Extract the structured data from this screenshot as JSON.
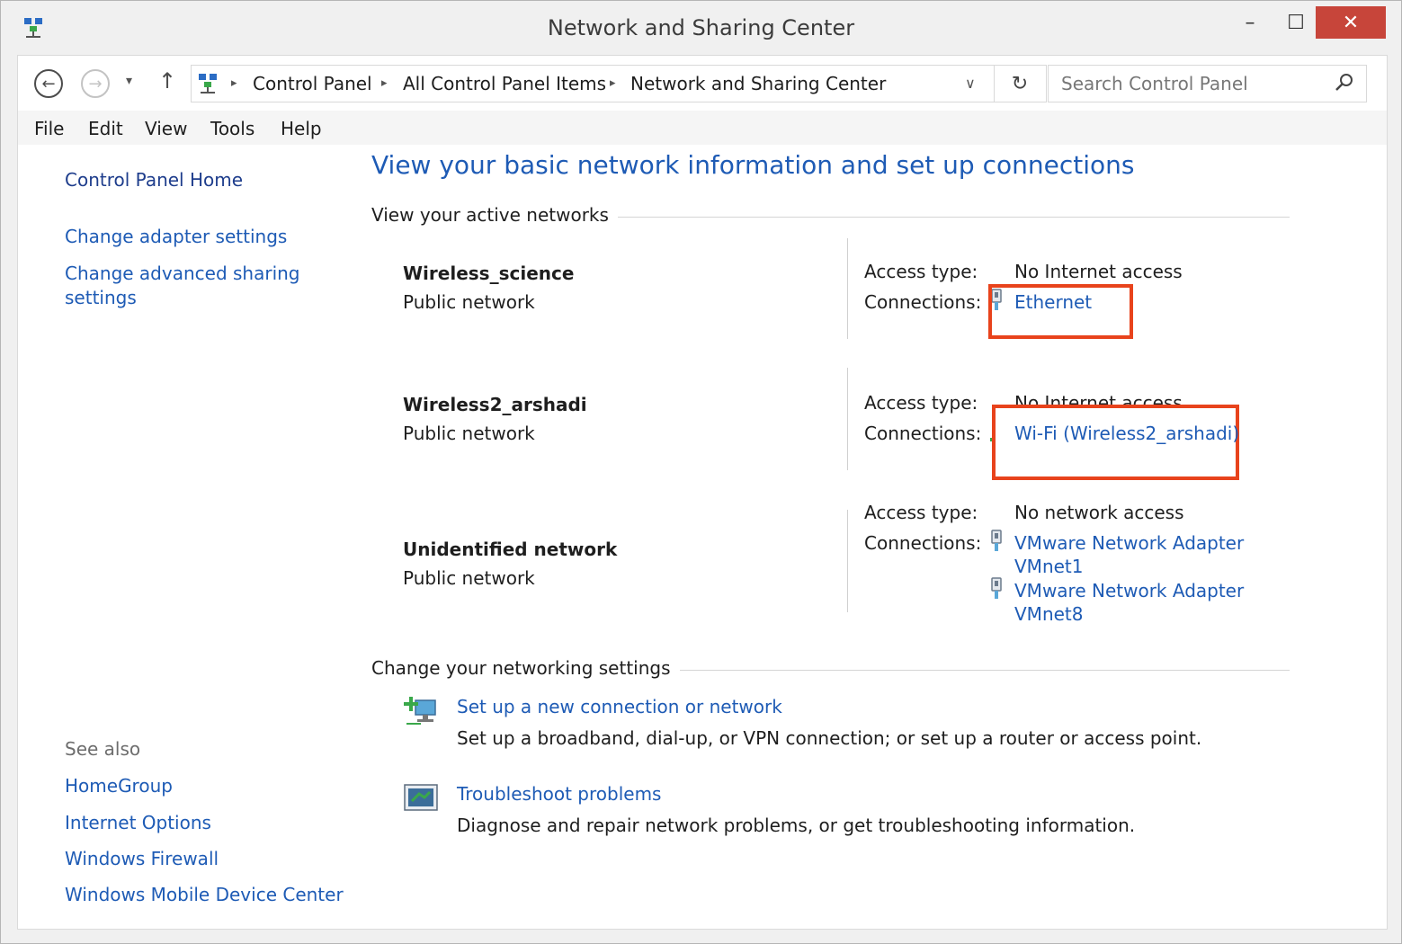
{
  "window": {
    "title": "Network and Sharing Center",
    "minimize_glyph": "–",
    "maximize_glyph": "☐",
    "close_glyph": "✕"
  },
  "nav": {
    "back_glyph": "←",
    "forward_glyph": "→",
    "dropdown_glyph": "▾",
    "up_glyph": "↑",
    "breadcrumbs": [
      "Control Panel",
      "All Control Panel Items",
      "Network and Sharing Center"
    ],
    "breadcrumb_sep": "▸",
    "address_dropdown_glyph": "∨",
    "refresh_glyph": "↻"
  },
  "search": {
    "placeholder": "Search Control Panel",
    "icon": "search-icon"
  },
  "menu": {
    "items": [
      "File",
      "Edit",
      "View",
      "Tools",
      "Help"
    ]
  },
  "sidebar": {
    "home": "Control Panel Home",
    "links": [
      "Change adapter settings",
      "Change advanced sharing",
      "settings"
    ],
    "see_also_title": "See also",
    "see_also": [
      "HomeGroup",
      "Internet Options",
      "Windows Firewall",
      "Windows Mobile Device Center"
    ]
  },
  "main": {
    "heading": "View your basic network information and set up connections",
    "active_networks_title": "View your active networks",
    "access_type_label": "Access type:",
    "connections_label": "Connections:",
    "networks": [
      {
        "name": "Wireless_science",
        "type": "Public network",
        "access_type": "No Internet access",
        "connections": [
          "Ethernet"
        ]
      },
      {
        "name": "Wireless2_arshadi",
        "type": "Public network",
        "access_type": "No Internet access",
        "connections": [
          "Wi-Fi (Wireless2_arshadi)"
        ]
      },
      {
        "name": "Unidentified network",
        "type": "Public network",
        "access_type": "No network access",
        "connections": [
          "VMware Network Adapter",
          "VMnet1",
          "VMware Network Adapter",
          "VMnet8"
        ]
      }
    ],
    "settings_title": "Change your networking settings",
    "tasks": [
      {
        "link": "Set up a new connection or network",
        "description": "Set up a broadband, dial-up, or VPN connection; or set up a router or access point."
      },
      {
        "link": "Troubleshoot problems",
        "description": "Diagnose and repair network problems, or get troubleshooting information."
      }
    ]
  },
  "colors": {
    "link": "#1e5bb5",
    "highlight_box": "#e8431c",
    "close_button": "#c7453a"
  }
}
